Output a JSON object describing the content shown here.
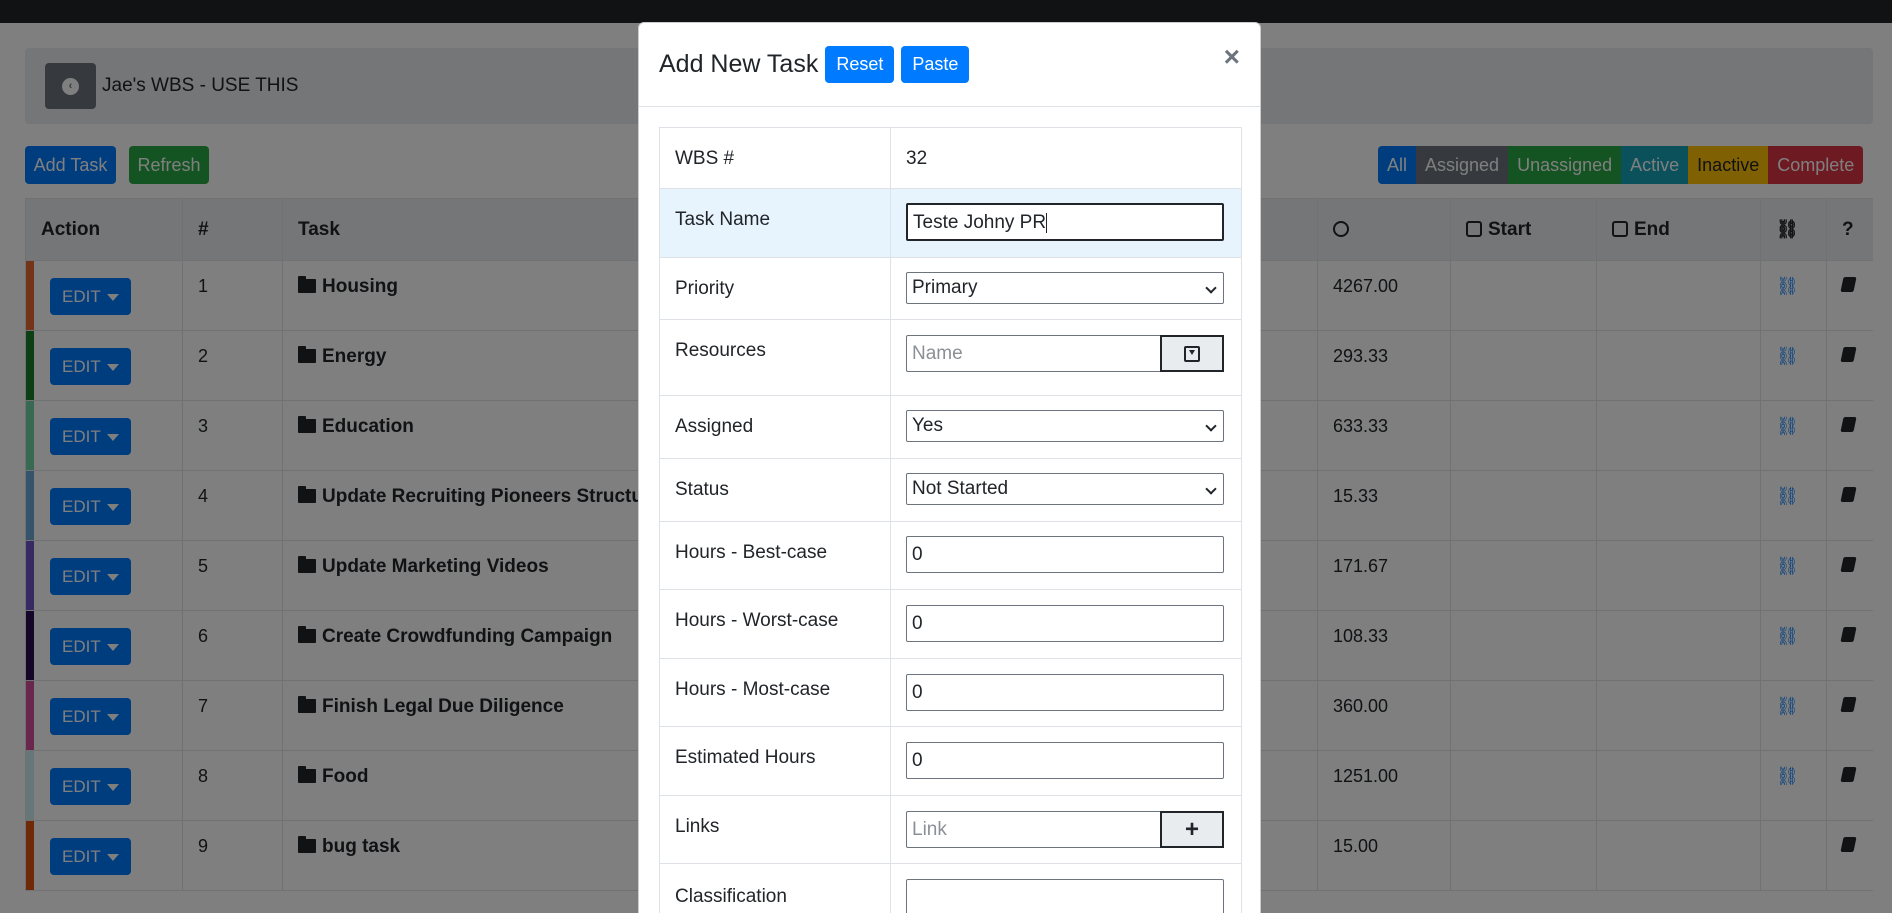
{
  "page": {
    "wbs_title": "Jae's WBS - USE THIS",
    "add_task_label": "Add Task",
    "refresh_label": "Refresh",
    "filters": [
      "All",
      "Assigned",
      "Unassigned",
      "Active",
      "Inactive",
      "Complete"
    ]
  },
  "table": {
    "columns": {
      "action": "Action",
      "num": "#",
      "task": "Task",
      "start": "Start",
      "end": "End",
      "help": "?"
    },
    "edit_label": "EDIT",
    "rows": [
      {
        "num": "1",
        "task": "Housing",
        "hours": "4267.00",
        "color": "#e8692f",
        "link": true
      },
      {
        "num": "2",
        "task": "Energy",
        "hours": "293.33",
        "color": "#1b7f2a",
        "link": true
      },
      {
        "num": "3",
        "task": "Education",
        "hours": "633.33",
        "color": "#6fd3a7",
        "link": true
      },
      {
        "num": "4",
        "task": "Update Recruiting Pioneers Structure",
        "hours": "15.33",
        "color": "#6aa7d6",
        "link": true
      },
      {
        "num": "5",
        "task": "Update Marketing Videos",
        "hours": "171.67",
        "color": "#6f52c7",
        "link": true
      },
      {
        "num": "6",
        "task": "Create Crowdfunding Campaign",
        "hours": "108.33",
        "color": "#2b0a52",
        "link": true
      },
      {
        "num": "7",
        "task": "Finish Legal Due Diligence",
        "hours": "360.00",
        "color": "#d24f9a",
        "link": true
      },
      {
        "num": "8",
        "task": "Food",
        "hours": "1251.00",
        "color": "#cfeff0",
        "link": true
      },
      {
        "num": "9",
        "task": "bug task",
        "hours": "15.00",
        "color": "#e0520f",
        "link": false
      }
    ]
  },
  "modal": {
    "title": "Add New Task",
    "reset_label": "Reset",
    "paste_label": "Paste",
    "close_label": "×",
    "fields": {
      "wbs_label": "WBS #",
      "wbs_value": "32",
      "task_name_label": "Task Name",
      "task_name_value": "Teste Johny PR",
      "priority_label": "Priority",
      "priority_value": "Primary",
      "resources_label": "Resources",
      "resources_placeholder": "Name",
      "assigned_label": "Assigned",
      "assigned_value": "Yes",
      "status_label": "Status",
      "status_value": "Not Started",
      "best_label": "Hours - Best-case",
      "best_value": "0",
      "worst_label": "Hours - Worst-case",
      "worst_value": "0",
      "most_label": "Hours - Most-case",
      "most_value": "0",
      "est_label": "Estimated Hours",
      "est_value": "0",
      "links_label": "Links",
      "links_placeholder": "Link",
      "classification_label": "Classification",
      "classification_value": ""
    }
  }
}
